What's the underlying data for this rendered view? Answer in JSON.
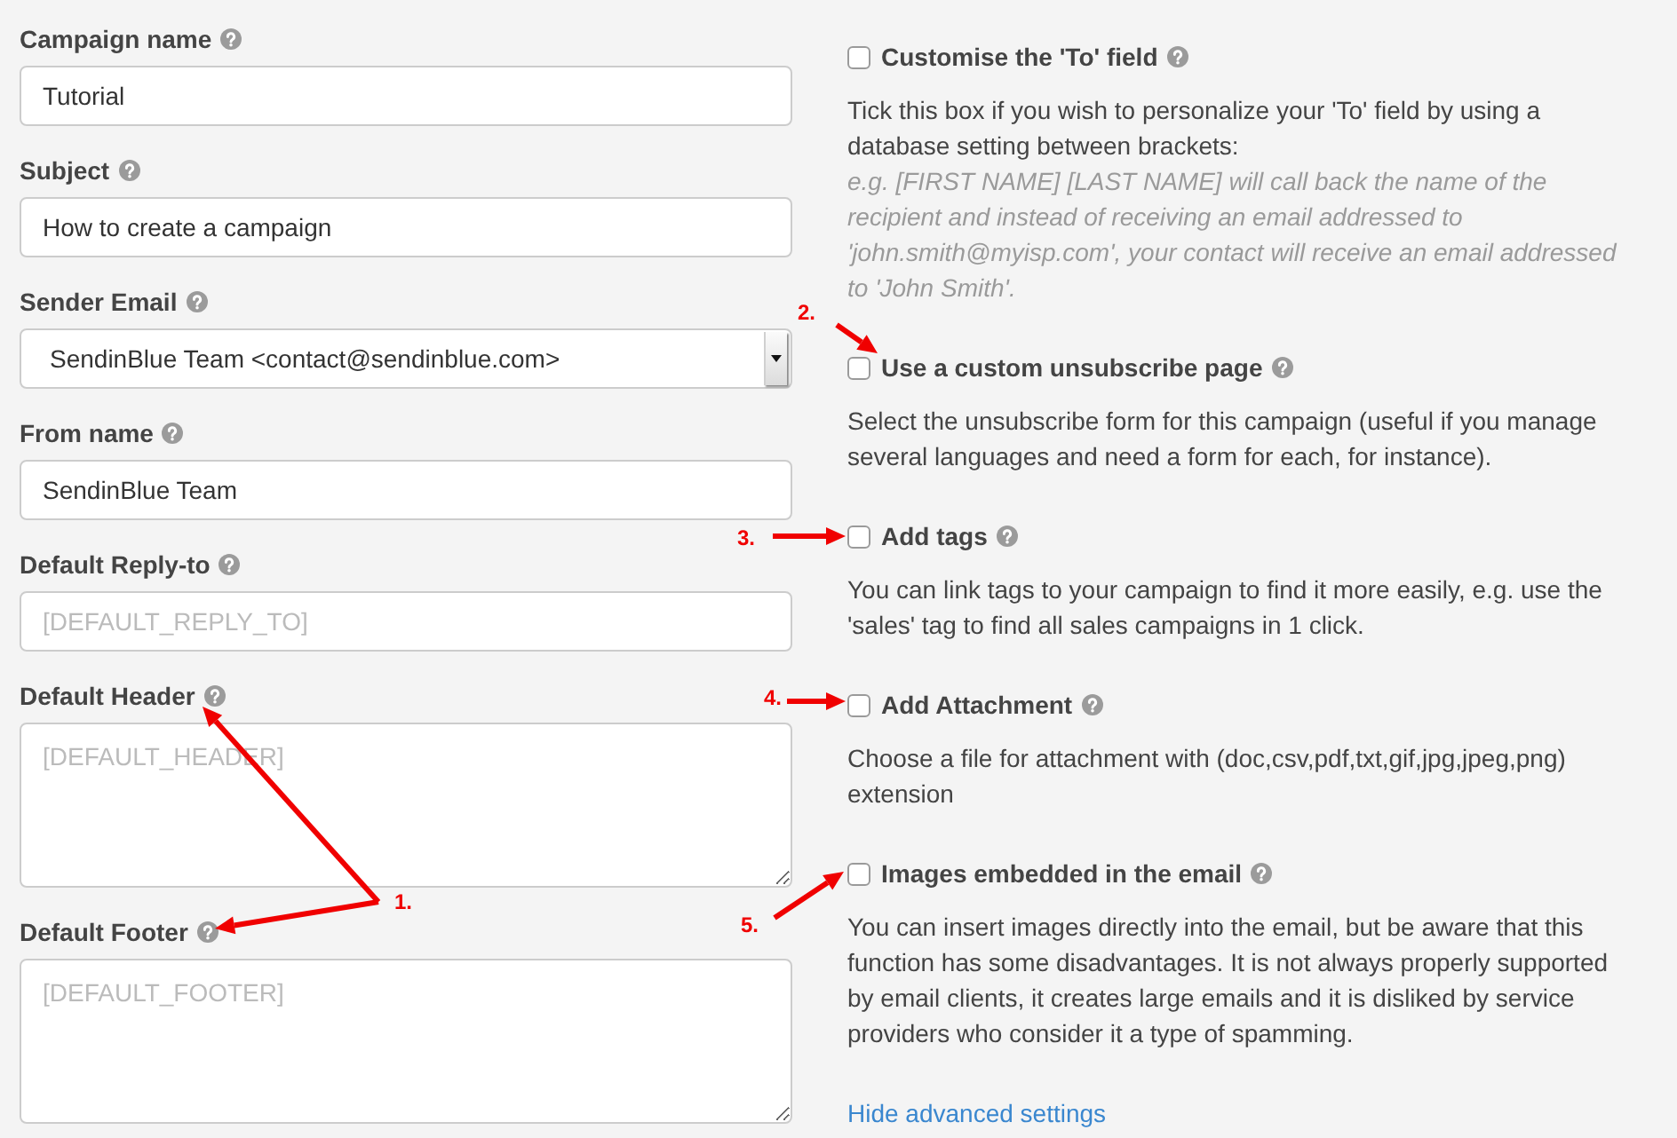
{
  "fields": [
    {
      "kind": "text",
      "label": "Campaign name",
      "value": "Tutorial"
    },
    {
      "kind": "text",
      "label": "Subject",
      "value": "How to create a campaign"
    },
    {
      "kind": "select",
      "label": "Sender Email",
      "value": "SendinBlue Team <contact@sendinblue.com>"
    },
    {
      "kind": "text",
      "label": "From name",
      "value": "SendinBlue Team"
    },
    {
      "kind": "text",
      "label": "Default Reply-to",
      "placeholder": "[DEFAULT_REPLY_TO]"
    },
    {
      "kind": "textarea",
      "label": "Default Header",
      "placeholder": "[DEFAULT_HEADER]"
    },
    {
      "kind": "textarea",
      "label": "Default Footer",
      "placeholder": "[DEFAULT_FOOTER]"
    }
  ],
  "options": [
    {
      "label": "Customise the 'To' field",
      "checked": false,
      "description": "Tick this box if you wish to personalize your 'To' field by using a database setting between brackets:",
      "example": "e.g. [FIRST NAME] [LAST NAME] will call back the name of the recipient and instead of receiving an email addressed to 'john.smith@myisp.com', your contact will receive an email addressed to 'John Smith'."
    },
    {
      "label": "Use a custom unsubscribe page",
      "checked": false,
      "description": "Select the unsubscribe form for this campaign (useful if you manage several languages and need a form for each, for instance)."
    },
    {
      "label": "Add tags",
      "checked": false,
      "description": "You can link tags to your campaign to find it more easily, e.g. use the 'sales' tag to find all sales campaigns in 1 click."
    },
    {
      "label": "Add Attachment",
      "checked": false,
      "description": "Choose a file for attachment with (doc,csv,pdf,txt,gif,jpg,jpeg,png) extension"
    },
    {
      "label": "Images embedded in the email",
      "checked": false,
      "description": "You can insert images directly into the email, but be aware that this function has some disadvantages. It is not always properly supported by email clients, it creates large emails and it is disliked by service providers who consider it a type of spamming."
    }
  ],
  "advanced_link": {
    "label": "Hide advanced settings"
  },
  "annotations": [
    {
      "label": "1."
    },
    {
      "label": "2."
    },
    {
      "label": "3."
    },
    {
      "label": "4."
    },
    {
      "label": "5."
    }
  ]
}
